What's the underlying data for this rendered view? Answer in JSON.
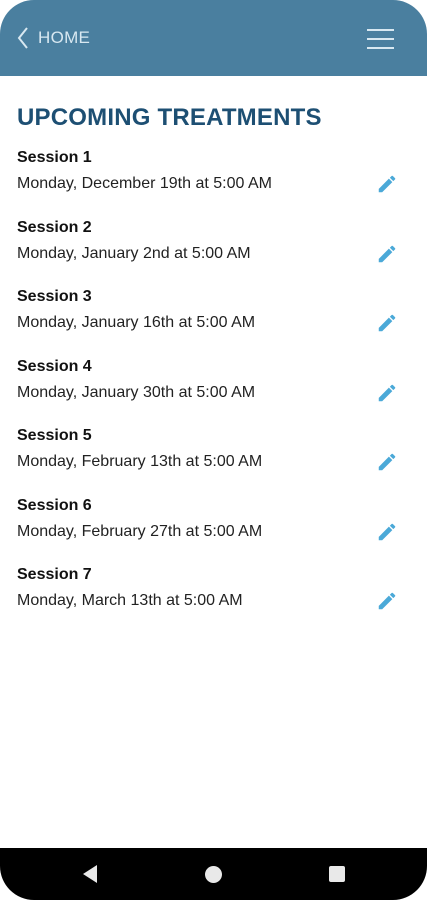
{
  "header": {
    "back_label": "HOME",
    "back_icon": "chevron-left-icon",
    "menu_icon": "hamburger-menu-icon",
    "background_color": "#4a7f9f"
  },
  "page": {
    "title": "UPCOMING TREATMENTS",
    "title_color": "#1d4f73",
    "accent_color": "#4ba9d8"
  },
  "sessions": [
    {
      "title": "Session 1",
      "date": "Monday, December 19th at 5:00 AM"
    },
    {
      "title": "Session 2",
      "date": "Monday, January 2nd at 5:00 AM"
    },
    {
      "title": "Session 3",
      "date": "Monday, January 16th at 5:00 AM"
    },
    {
      "title": "Session 4",
      "date": "Monday, January 30th at 5:00 AM"
    },
    {
      "title": "Session 5",
      "date": "Monday, February 13th at 5:00 AM"
    },
    {
      "title": "Session 6",
      "date": "Monday, February 27th at 5:00 AM"
    },
    {
      "title": "Session 7",
      "date": "Monday, March 13th at 5:00 AM"
    }
  ],
  "navbar": {
    "back_icon": "triangle-back-icon",
    "home_icon": "circle-home-icon",
    "recents_icon": "square-recents-icon"
  }
}
